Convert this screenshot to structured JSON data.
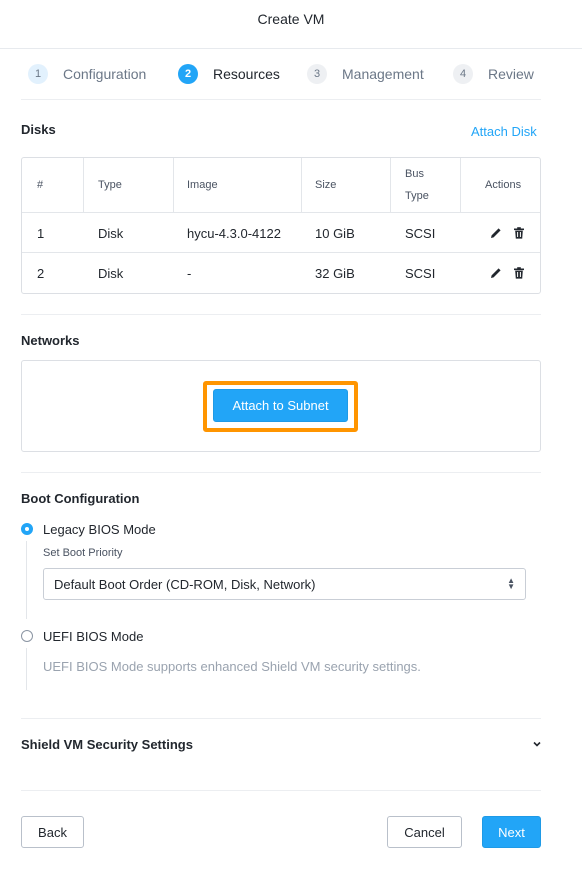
{
  "dialog": {
    "title": "Create VM"
  },
  "steps": [
    {
      "number": "1",
      "label": "Configuration",
      "state": "done"
    },
    {
      "number": "2",
      "label": "Resources",
      "state": "active"
    },
    {
      "number": "3",
      "label": "Management",
      "state": "pending"
    },
    {
      "number": "4",
      "label": "Review",
      "state": "pending"
    }
  ],
  "disks": {
    "title": "Disks",
    "attach_label": "Attach Disk",
    "columns": {
      "num": "#",
      "type": "Type",
      "image": "Image",
      "size": "Size",
      "bus_line1": "Bus",
      "bus_line2": "Type",
      "actions": "Actions"
    },
    "rows": [
      {
        "num": "1",
        "type": "Disk",
        "image": "hycu-4.3.0-4122",
        "size": "10 GiB",
        "bus": "SCSI",
        "actions": [
          "edit-icon",
          "delete-icon"
        ]
      },
      {
        "num": "2",
        "type": "Disk",
        "image": "-",
        "size": "32 GiB",
        "bus": "SCSI",
        "actions": [
          "edit-icon",
          "delete-icon"
        ]
      }
    ]
  },
  "networks": {
    "title": "Networks",
    "attach_subnet_label": "Attach to Subnet"
  },
  "boot": {
    "title": "Boot Configuration",
    "legacy_label": "Legacy BIOS Mode",
    "legacy_selected": true,
    "priority_label": "Set Boot Priority",
    "priority_value": "Default Boot Order (CD-ROM, Disk, Network)",
    "uefi_label": "UEFI BIOS Mode",
    "uefi_selected": false,
    "uefi_hint": "UEFI BIOS Mode supports enhanced Shield VM security settings."
  },
  "shield": {
    "title": "Shield VM Security Settings",
    "expanded": false
  },
  "footer": {
    "back_label": "Back",
    "cancel_label": "Cancel",
    "next_label": "Next"
  },
  "colors": {
    "accent": "#22a5f7",
    "highlight": "#ff9500",
    "text": "#22272e",
    "muted": "#9aa3af"
  }
}
